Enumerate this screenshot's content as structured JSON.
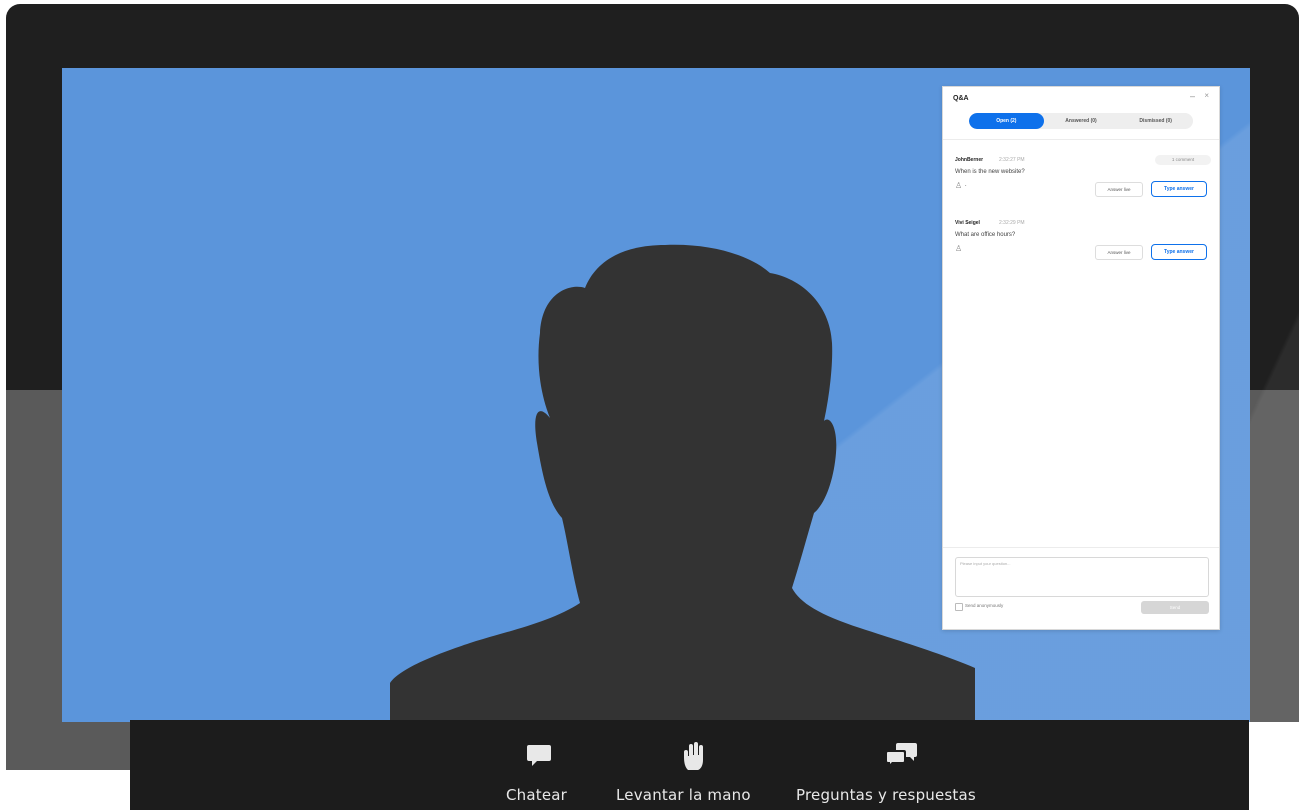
{
  "qa_panel": {
    "title": "Q&A",
    "minimize_icon": "minimize-icon",
    "close_icon": "close-icon",
    "tabs": [
      {
        "label": "Open (2)",
        "active": true
      },
      {
        "label": "Answered (0)",
        "active": false
      },
      {
        "label": "Dismissed (0)",
        "active": false
      }
    ],
    "questions": [
      {
        "author": "JohnBerner",
        "time": "2:32:27 PM",
        "text": "When is the new website?",
        "comment_label": "1 comment",
        "answer_live_label": "Answer live",
        "type_answer_label": "Type answer"
      },
      {
        "author": "Vivi Seigel",
        "time": "2:32:29 PM",
        "text": "What are office hours?",
        "answer_live_label": "Answer live",
        "type_answer_label": "Type answer"
      }
    ],
    "input_placeholder": "Please input your question...",
    "anonymous_label": "Send anonymously",
    "send_label": "Send"
  },
  "toolbar": {
    "items": [
      {
        "label": "Chatear",
        "icon": "chat-bubble-icon"
      },
      {
        "label": "Levantar la mano",
        "icon": "raise-hand-icon"
      },
      {
        "label": "Preguntas y respuestas",
        "icon": "qa-bubbles-icon"
      }
    ]
  },
  "colors": {
    "screen_background": "#5b95db",
    "accent": "#0e71eb",
    "toolbar_background": "#1c1c1c",
    "silhouette": "#333333"
  }
}
